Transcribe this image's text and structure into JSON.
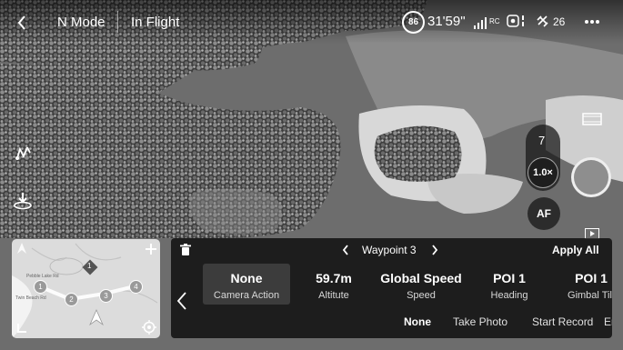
{
  "header": {
    "back_icon": "chevron-left-icon",
    "mode": "N Mode",
    "status": "In Flight",
    "battery_percent": "86",
    "flight_time": "31'59\"",
    "signal_label": "RC",
    "satellite_count": "26"
  },
  "camera": {
    "zoom_level": "7",
    "zoom_factor": "1.0×",
    "focus_mode": "AF"
  },
  "waypoint_panel": {
    "title": "Waypoint 3",
    "apply_all": "Apply All",
    "params": [
      {
        "value": "None",
        "label": "Camera Action"
      },
      {
        "value": "59.7m",
        "label": "Altitute"
      },
      {
        "value": "Global Speed",
        "label": "Speed"
      },
      {
        "value": "POI 1",
        "label": "Heading"
      },
      {
        "value": "POI 1",
        "label": "Gimbal Tilt"
      }
    ],
    "actions": [
      "None",
      "Take Photo",
      "Start Record",
      "End Record"
    ]
  },
  "minimap": {
    "place_labels": [
      "Pebble Lake Rd",
      "Twin Beach Rd"
    ],
    "waypoints": [
      "1",
      "2",
      "3",
      "4"
    ],
    "poi": "1"
  },
  "colors": {
    "panel_bg": "#121212",
    "selected_item": "#3c3c3c",
    "shutter": "#8e8e8e"
  }
}
